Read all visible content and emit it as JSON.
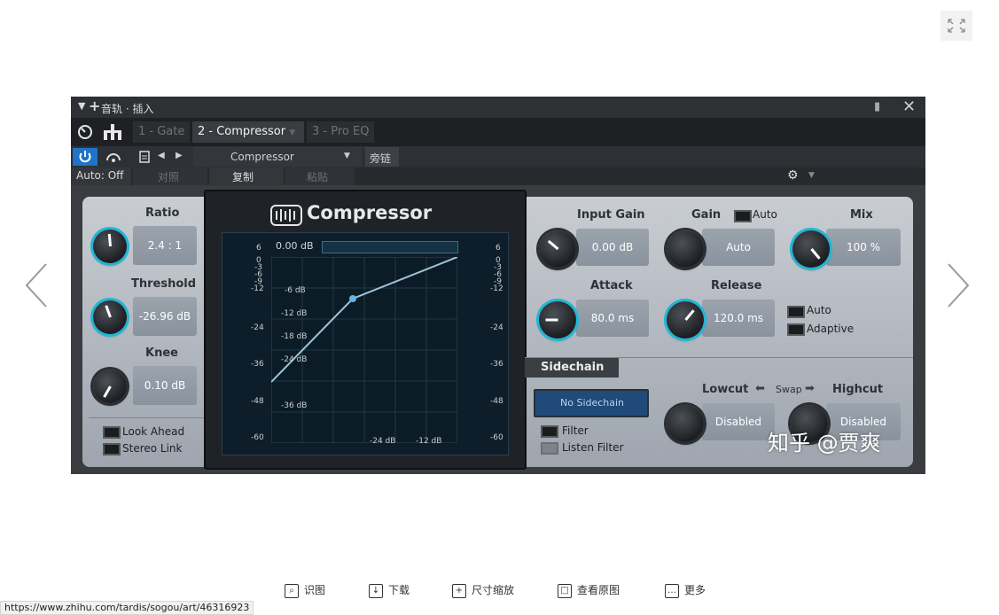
{
  "viewer": {
    "fullscreen_icon": "expand-icon",
    "prev_icon": "chevron-left-icon",
    "next_icon": "chevron-right-icon",
    "watermark": "知乎 @贾爽",
    "toolbar": [
      {
        "label": "识图",
        "icon": "image-search-icon"
      },
      {
        "label": "下载",
        "icon": "download-icon"
      },
      {
        "label": "尺寸缩放",
        "icon": "zoom-icon"
      },
      {
        "label": "查看原图",
        "icon": "original-image-icon"
      },
      {
        "label": "更多",
        "icon": "more-icon"
      }
    ],
    "status_url": "https://www.zhihu.com/tardis/sogou/art/46316923"
  },
  "plugin": {
    "title": "音轨 · 插入",
    "tabs": [
      "1 - Gate",
      "2 - Compressor",
      "3 - Pro EQ"
    ],
    "active_tab": 1,
    "preset_name": "Compressor",
    "sidechain_btn": "旁链",
    "auto_status": "Auto: Off",
    "compare": "对照",
    "copy": "复制",
    "paste": "粘贴",
    "brand_title": "Compressor",
    "left": {
      "ratio_label": "Ratio",
      "ratio_value": "2.4 : 1",
      "threshold_label": "Threshold",
      "threshold_value": "-26.96 dB",
      "knee_label": "Knee",
      "knee_value": "0.10 dB",
      "look_ahead": "Look Ahead",
      "stereo_link": "Stereo Link"
    },
    "display": {
      "top_value": "0.00 dB",
      "left_scale": [
        "6",
        "0",
        "-3",
        "-6",
        "-9",
        "-12",
        "-24",
        "-36",
        "-48",
        "-60"
      ],
      "right_scale": [
        "6",
        "0",
        "-3",
        "-6",
        "-9",
        "-12",
        "-24",
        "-36",
        "-48",
        "-60"
      ],
      "graph_labels": [
        "-6 dB",
        "-12 dB",
        "-18 dB",
        "-24 dB",
        "-36 dB",
        "-24 dB",
        "-12 dB"
      ]
    },
    "right": {
      "input_gain_label": "Input Gain",
      "input_gain_value": "0.00 dB",
      "gain_label": "Gain",
      "gain_auto": "Auto",
      "gain_value": "Auto",
      "mix_label": "Mix",
      "mix_value": "100 %",
      "attack_label": "Attack",
      "attack_value": "80.0 ms",
      "release_label": "Release",
      "release_value": "120.0 ms",
      "release_auto": "Auto",
      "release_adaptive": "Adaptive",
      "sidechain_label": "Sidechain",
      "no_sidechain": "No Sidechain",
      "filter": "Filter",
      "listen_filter": "Listen Filter",
      "lowcut_label": "Lowcut",
      "swap_label": "Swap",
      "highcut_label": "Highcut",
      "lowcut_value": "Disabled",
      "highcut_value": "Disabled"
    }
  }
}
